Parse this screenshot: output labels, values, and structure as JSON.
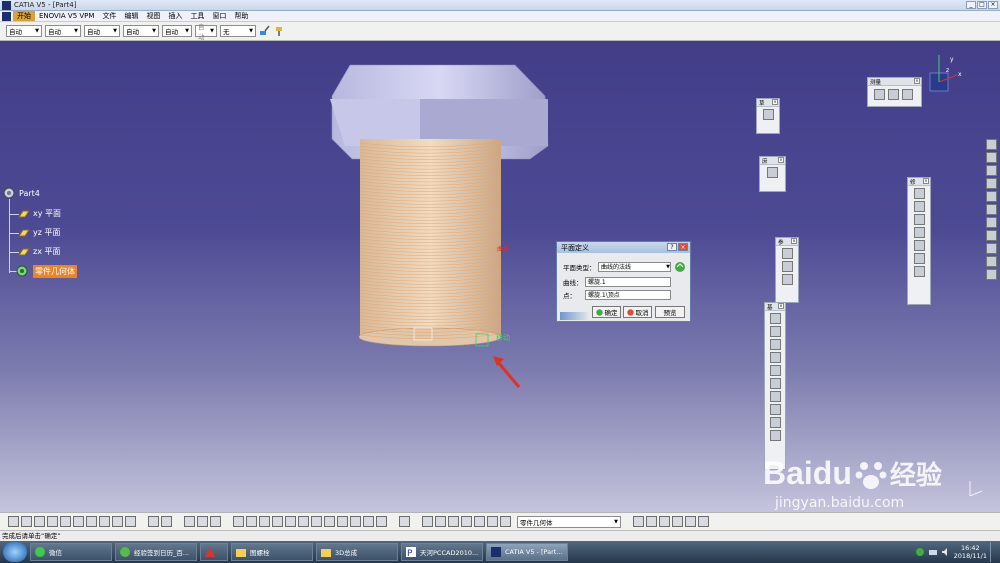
{
  "window": {
    "title": "CATIA V5 - [Part4]",
    "controls": [
      "_",
      "□",
      "×"
    ]
  },
  "menu": {
    "items": [
      "开始",
      "ENOVIA V5 VPM",
      "文件",
      "编辑",
      "视图",
      "插入",
      "工具",
      "窗口",
      "帮助"
    ]
  },
  "properties": {
    "combos": [
      "自动",
      "自动",
      "自动",
      "自动",
      "自动",
      "自动",
      "无"
    ]
  },
  "tree": {
    "root": "Part4",
    "items": [
      "xy 平面",
      "yz 平面",
      "zx 平面",
      "零件几何体"
    ]
  },
  "viewport_labels": {
    "curve_tag": "曲线",
    "move_tag": "移动"
  },
  "panels": {
    "measure": "测量",
    "p1": "草",
    "p2": "庶",
    "p3": "参",
    "p4": "基",
    "p5": "修"
  },
  "dialog": {
    "title": "平面定义",
    "type_label": "平面类型：",
    "type_value": "曲线的法线",
    "curve_label": "曲线：",
    "curve_value": "螺旋.1",
    "point_label": "点：",
    "point_value": "螺旋.1\\顶点",
    "ok": "确定",
    "cancel": "取消",
    "preview": "预览",
    "ctrl_help": "?",
    "ctrl_close": "×"
  },
  "bottom_toolbar": {
    "geometry_combo": "零件几何体"
  },
  "status": {
    "text": "完成后请单击“确定”"
  },
  "taskbar": {
    "tasks": [
      "微信",
      "经验签到日历_百...",
      "",
      "图螺栓",
      "3D总成",
      "天河PCCAD2010...",
      "CATIA V5 - [Part..."
    ],
    "time": "16:42",
    "date": "2018/11/1"
  },
  "watermark": {
    "brand": "Baidu",
    "suffix": "经验",
    "url": "jingyan.baidu.com"
  },
  "colors": {
    "accent": "#e8842a",
    "viewport_top": "#433d88",
    "dialog_border": "#5f7fa8"
  }
}
